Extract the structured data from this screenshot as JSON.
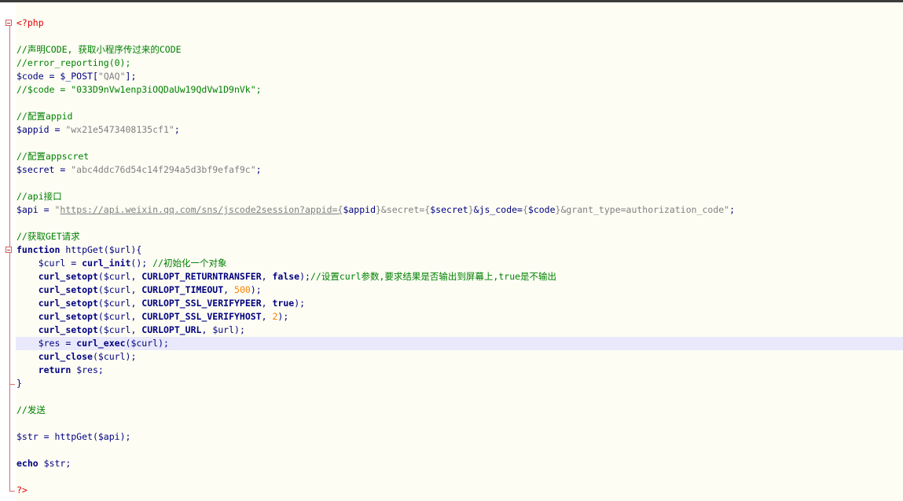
{
  "editor": {
    "lines": [
      {
        "fold": "start",
        "tokens": [
          {
            "t": "php",
            "v": "<?php"
          }
        ]
      },
      {
        "fold": "bar",
        "tokens": []
      },
      {
        "fold": "bar",
        "tokens": [
          {
            "t": "comment",
            "v": "//声明CODE, 获取小程序传过来的CODE"
          }
        ]
      },
      {
        "fold": "bar",
        "tokens": [
          {
            "t": "comment",
            "v": "//error_reporting(0);"
          }
        ]
      },
      {
        "fold": "bar",
        "tokens": [
          {
            "t": "var",
            "v": "$code"
          },
          {
            "t": "plain",
            "v": " = "
          },
          {
            "t": "var",
            "v": "$_POST"
          },
          {
            "t": "plain",
            "v": "["
          },
          {
            "t": "str",
            "v": "\"QAQ\""
          },
          {
            "t": "plain",
            "v": "];"
          }
        ]
      },
      {
        "fold": "bar",
        "tokens": [
          {
            "t": "comment",
            "v": "//$code = \"033D9nVw1enp3iOQDaUw19QdVw1D9nVk\";"
          }
        ]
      },
      {
        "fold": "bar",
        "tokens": []
      },
      {
        "fold": "bar",
        "tokens": [
          {
            "t": "comment",
            "v": "//配置appid"
          }
        ]
      },
      {
        "fold": "bar",
        "tokens": [
          {
            "t": "var",
            "v": "$appid"
          },
          {
            "t": "plain",
            "v": " = "
          },
          {
            "t": "str",
            "v": "\"wx21e5473408135cf1\""
          },
          {
            "t": "plain",
            "v": ";"
          }
        ]
      },
      {
        "fold": "bar",
        "tokens": []
      },
      {
        "fold": "bar",
        "tokens": [
          {
            "t": "comment",
            "v": "//配置appscret"
          }
        ]
      },
      {
        "fold": "bar",
        "tokens": [
          {
            "t": "var",
            "v": "$secret"
          },
          {
            "t": "plain",
            "v": " = "
          },
          {
            "t": "str",
            "v": "\"abc4ddc76d54c14f294a5d3bf9efaf9c\""
          },
          {
            "t": "plain",
            "v": ";"
          }
        ]
      },
      {
        "fold": "bar",
        "tokens": []
      },
      {
        "fold": "bar",
        "tokens": [
          {
            "t": "comment",
            "v": "//api接口"
          }
        ]
      },
      {
        "fold": "bar",
        "tokens": [
          {
            "t": "var",
            "v": "$api"
          },
          {
            "t": "plain",
            "v": " = "
          },
          {
            "t": "str",
            "v": "\""
          },
          {
            "t": "link",
            "v": "https://api.weixin.qq.com/sns/jscode2session?appid={"
          },
          {
            "t": "var",
            "v": "$appid"
          },
          {
            "t": "str",
            "v": "}&secret={"
          },
          {
            "t": "var",
            "v": "$secret"
          },
          {
            "t": "str",
            "v": "}"
          },
          {
            "t": "var",
            "v": "&js_code="
          },
          {
            "t": "str",
            "v": "{"
          },
          {
            "t": "var",
            "v": "$code"
          },
          {
            "t": "str",
            "v": "}&grant_type=authorization_code\""
          },
          {
            "t": "plain",
            "v": ";"
          }
        ]
      },
      {
        "fold": "bar",
        "tokens": []
      },
      {
        "fold": "bar",
        "tokens": [
          {
            "t": "comment",
            "v": "//获取GET请求"
          }
        ]
      },
      {
        "fold": "start",
        "tokens": [
          {
            "t": "kw",
            "v": "function"
          },
          {
            "t": "plain",
            "v": " httpGet("
          },
          {
            "t": "var",
            "v": "$url"
          },
          {
            "t": "plain",
            "v": "){"
          }
        ]
      },
      {
        "fold": "bar",
        "tokens": [
          {
            "t": "plain",
            "v": "    "
          },
          {
            "t": "var",
            "v": "$curl"
          },
          {
            "t": "plain",
            "v": " = "
          },
          {
            "t": "kw",
            "v": "curl_init"
          },
          {
            "t": "plain",
            "v": "(); "
          },
          {
            "t": "comment",
            "v": "//初始化一个对象"
          }
        ]
      },
      {
        "fold": "bar",
        "tokens": [
          {
            "t": "plain",
            "v": "    "
          },
          {
            "t": "kw",
            "v": "curl_setopt"
          },
          {
            "t": "plain",
            "v": "("
          },
          {
            "t": "var",
            "v": "$curl"
          },
          {
            "t": "plain",
            "v": ", "
          },
          {
            "t": "kw",
            "v": "CURLOPT_RETURNTRANSFER"
          },
          {
            "t": "plain",
            "v": ", "
          },
          {
            "t": "kw",
            "v": "false"
          },
          {
            "t": "plain",
            "v": ");"
          },
          {
            "t": "comment",
            "v": "//设置curl参数,要求结果是否输出到屏幕上,true是不输出"
          }
        ]
      },
      {
        "fold": "bar",
        "tokens": [
          {
            "t": "plain",
            "v": "    "
          },
          {
            "t": "kw",
            "v": "curl_setopt"
          },
          {
            "t": "plain",
            "v": "("
          },
          {
            "t": "var",
            "v": "$curl"
          },
          {
            "t": "plain",
            "v": ", "
          },
          {
            "t": "kw",
            "v": "CURLOPT_TIMEOUT"
          },
          {
            "t": "plain",
            "v": ", "
          },
          {
            "t": "num",
            "v": "500"
          },
          {
            "t": "plain",
            "v": ");"
          }
        ]
      },
      {
        "fold": "bar",
        "tokens": [
          {
            "t": "plain",
            "v": "    "
          },
          {
            "t": "kw",
            "v": "curl_setopt"
          },
          {
            "t": "plain",
            "v": "("
          },
          {
            "t": "var",
            "v": "$curl"
          },
          {
            "t": "plain",
            "v": ", "
          },
          {
            "t": "kw",
            "v": "CURLOPT_SSL_VERIFYPEER"
          },
          {
            "t": "plain",
            "v": ", "
          },
          {
            "t": "kw",
            "v": "true"
          },
          {
            "t": "plain",
            "v": ");"
          }
        ]
      },
      {
        "fold": "bar",
        "tokens": [
          {
            "t": "plain",
            "v": "    "
          },
          {
            "t": "kw",
            "v": "curl_setopt"
          },
          {
            "t": "plain",
            "v": "("
          },
          {
            "t": "var",
            "v": "$curl"
          },
          {
            "t": "plain",
            "v": ", "
          },
          {
            "t": "kw",
            "v": "CURLOPT_SSL_VERIFYHOST"
          },
          {
            "t": "plain",
            "v": ", "
          },
          {
            "t": "num",
            "v": "2"
          },
          {
            "t": "plain",
            "v": ");"
          }
        ]
      },
      {
        "fold": "bar",
        "tokens": [
          {
            "t": "plain",
            "v": "    "
          },
          {
            "t": "kw",
            "v": "curl_setopt"
          },
          {
            "t": "plain",
            "v": "("
          },
          {
            "t": "var",
            "v": "$curl"
          },
          {
            "t": "plain",
            "v": ", "
          },
          {
            "t": "kw",
            "v": "CURLOPT_URL"
          },
          {
            "t": "plain",
            "v": ", "
          },
          {
            "t": "var",
            "v": "$url"
          },
          {
            "t": "plain",
            "v": ");"
          }
        ]
      },
      {
        "fold": "bar",
        "highlight": true,
        "tokens": [
          {
            "t": "plain",
            "v": "    "
          },
          {
            "t": "var",
            "v": "$res"
          },
          {
            "t": "plain",
            "v": " = "
          },
          {
            "t": "kw",
            "v": "curl_exec"
          },
          {
            "t": "plain",
            "v": "("
          },
          {
            "t": "var",
            "v": "$curl"
          },
          {
            "t": "plain",
            "v": ");"
          }
        ]
      },
      {
        "fold": "bar",
        "tokens": [
          {
            "t": "plain",
            "v": "    "
          },
          {
            "t": "kw",
            "v": "curl_close"
          },
          {
            "t": "plain",
            "v": "("
          },
          {
            "t": "var",
            "v": "$curl"
          },
          {
            "t": "plain",
            "v": ");"
          }
        ]
      },
      {
        "fold": "bar",
        "tokens": [
          {
            "t": "plain",
            "v": "    "
          },
          {
            "t": "kw",
            "v": "return"
          },
          {
            "t": "plain",
            "v": " "
          },
          {
            "t": "var",
            "v": "$res"
          },
          {
            "t": "plain",
            "v": ";"
          }
        ]
      },
      {
        "fold": "end",
        "tokens": [
          {
            "t": "plain",
            "v": "}"
          }
        ]
      },
      {
        "fold": "bar",
        "tokens": []
      },
      {
        "fold": "bar",
        "tokens": [
          {
            "t": "comment",
            "v": "//发送"
          }
        ]
      },
      {
        "fold": "bar",
        "tokens": []
      },
      {
        "fold": "bar",
        "tokens": [
          {
            "t": "var",
            "v": "$str"
          },
          {
            "t": "plain",
            "v": " = httpGet("
          },
          {
            "t": "var",
            "v": "$api"
          },
          {
            "t": "plain",
            "v": ");"
          }
        ]
      },
      {
        "fold": "bar",
        "tokens": []
      },
      {
        "fold": "bar",
        "tokens": [
          {
            "t": "kw",
            "v": "echo"
          },
          {
            "t": "plain",
            "v": " "
          },
          {
            "t": "var",
            "v": "$str"
          },
          {
            "t": "plain",
            "v": ";"
          }
        ]
      },
      {
        "fold": "bar",
        "tokens": []
      },
      {
        "fold": "end",
        "tokens": [
          {
            "t": "php",
            "v": "?>"
          }
        ]
      }
    ]
  }
}
